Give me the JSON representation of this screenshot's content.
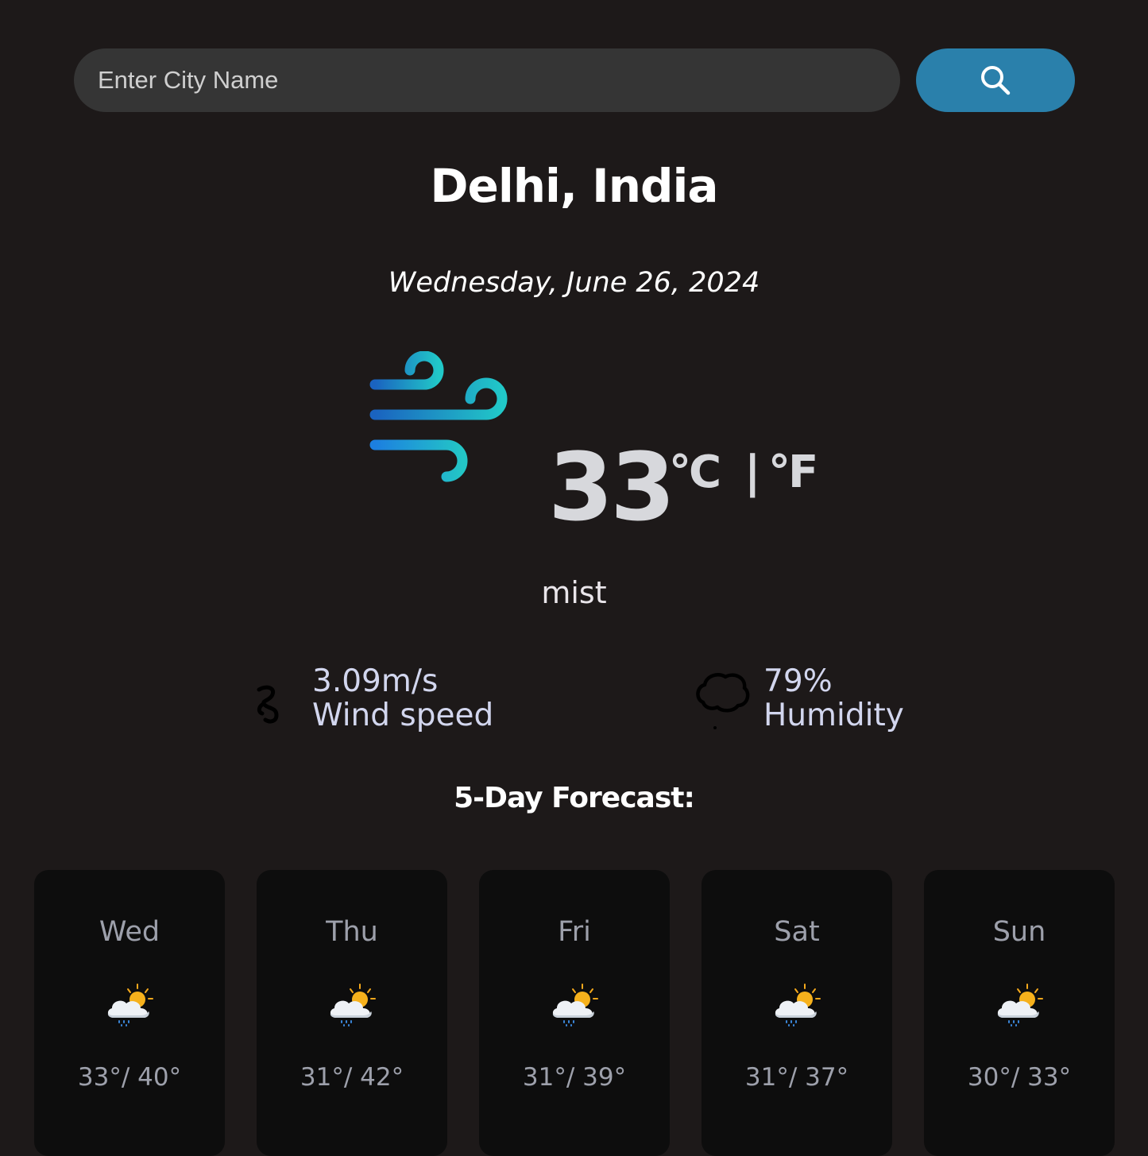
{
  "search": {
    "placeholder": "Enter City Name",
    "button_icon": "search-icon",
    "button_color": "#2a80ab"
  },
  "location": "Delhi, India",
  "date": "Wednesday, June 26, 2024",
  "current": {
    "icon": "wind-icon",
    "temperature": "33",
    "unit_c": "°C",
    "unit_sep": "|",
    "unit_f": "°F",
    "description": "mist"
  },
  "details": {
    "wind": {
      "icon": "wind-speed-icon",
      "value": "3.09m/s",
      "label": "Wind speed"
    },
    "humidity": {
      "icon": "cloud-icon",
      "value": "79%",
      "label": "Humidity"
    }
  },
  "forecast": {
    "title": "5-Day Forecast:",
    "days": [
      {
        "day": "Wed",
        "icon": "partly-cloudy-rain-icon",
        "temp": "33°/ 40°"
      },
      {
        "day": "Thu",
        "icon": "partly-cloudy-rain-icon",
        "temp": "31°/ 42°"
      },
      {
        "day": "Fri",
        "icon": "partly-cloudy-rain-icon",
        "temp": "31°/ 39°"
      },
      {
        "day": "Sat",
        "icon": "partly-cloudy-rain-icon",
        "temp": "31°/ 37°"
      },
      {
        "day": "Sun",
        "icon": "partly-cloudy-rain-icon",
        "temp": "30°/ 33°"
      }
    ]
  }
}
